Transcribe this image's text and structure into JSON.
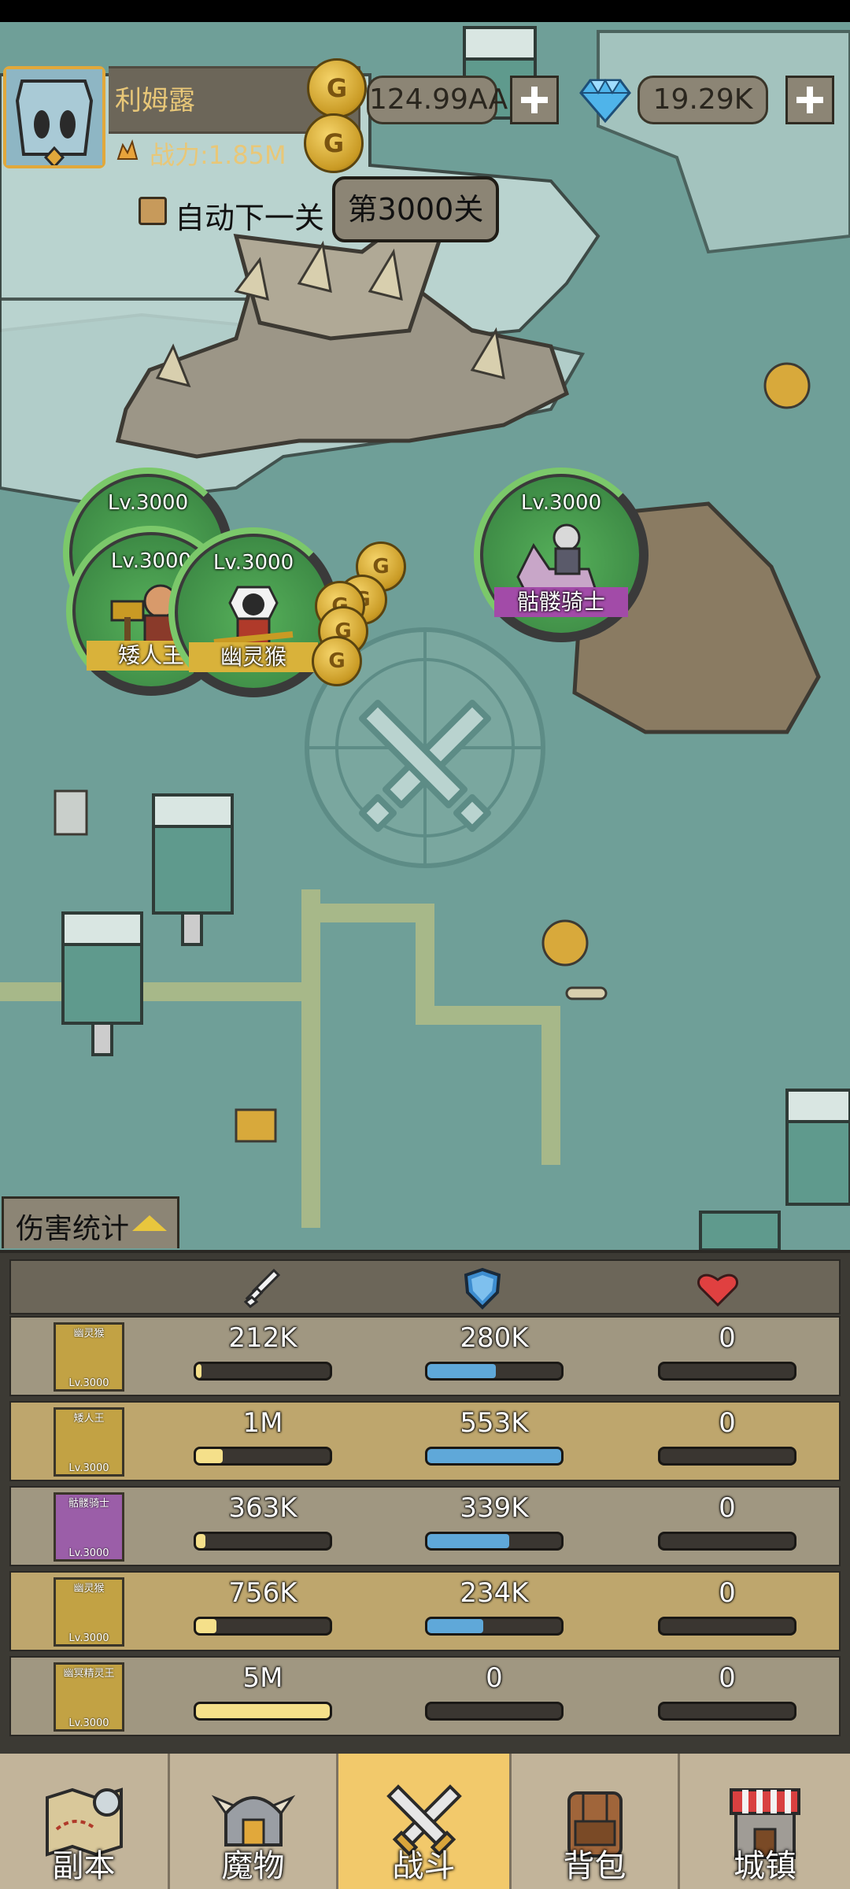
{
  "player": {
    "name": "利姆露",
    "power": "战力:1.85M"
  },
  "currency": {
    "gold": "124.99AA",
    "gems": "19.29K"
  },
  "controls": {
    "auto_next_label": "自动下一关",
    "level_label": "第3000关"
  },
  "units": [
    {
      "level": "Lv.3000",
      "name": ""
    },
    {
      "level": "Lv.3000",
      "name": "矮人王"
    },
    {
      "level": "Lv.3000",
      "name": "幽灵猴"
    },
    {
      "level": "Lv.3000",
      "name": "骷髅骑士"
    }
  ],
  "damage_stats": {
    "title": "伤害统计",
    "rows": [
      {
        "name": "幽灵猴",
        "level": "Lv.3000",
        "attack": "212K",
        "attack_pct": 4,
        "defense": "280K",
        "defense_pct": 51,
        "heal": "0",
        "heal_pct": 0
      },
      {
        "name": "矮人王",
        "level": "Lv.3000",
        "attack": "1M",
        "attack_pct": 20,
        "defense": "553K",
        "defense_pct": 100,
        "heal": "0",
        "heal_pct": 0
      },
      {
        "name": "骷髅骑士",
        "level": "Lv.3000",
        "attack": "363K",
        "attack_pct": 7,
        "defense": "339K",
        "defense_pct": 61,
        "heal": "0",
        "heal_pct": 0
      },
      {
        "name": "幽灵猴",
        "level": "Lv.3000",
        "attack": "756K",
        "attack_pct": 15,
        "defense": "234K",
        "defense_pct": 42,
        "heal": "0",
        "heal_pct": 0
      },
      {
        "name": "幽冥精灵王",
        "level": "Lv.3000",
        "attack": "5M",
        "attack_pct": 100,
        "defense": "0",
        "defense_pct": 0,
        "heal": "0",
        "heal_pct": 0
      }
    ]
  },
  "nav": [
    {
      "label": "副本",
      "icon": "map-icon"
    },
    {
      "label": "魔物",
      "icon": "helmet-icon"
    },
    {
      "label": "战斗",
      "icon": "crossed-swords-icon",
      "active": true
    },
    {
      "label": "背包",
      "icon": "backpack-icon"
    },
    {
      "label": "城镇",
      "icon": "shop-icon"
    }
  ],
  "colors": {
    "map_water": "#6f9f98",
    "panel_bg": "#3c3a34",
    "active_tab": "#f2c96b",
    "attack_bar": "#f5e08a",
    "defense_bar": "#5fa8d9"
  }
}
